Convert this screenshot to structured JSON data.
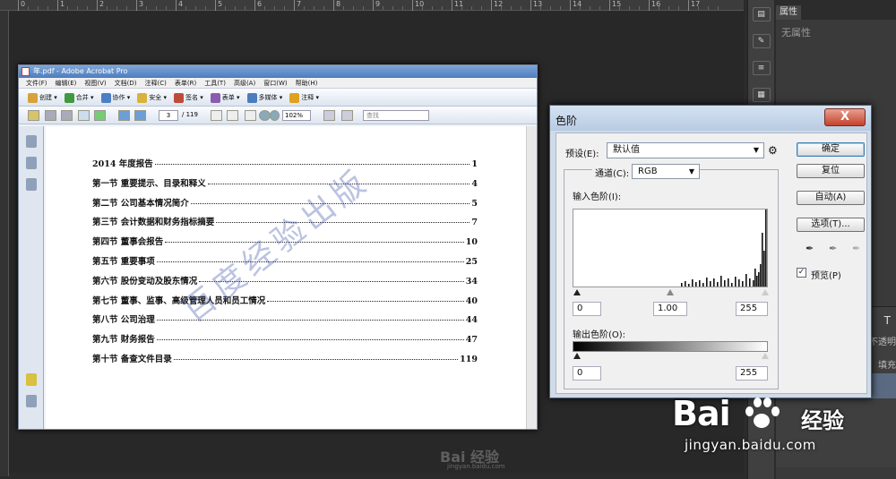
{
  "photoshop": {
    "ruler_marks": [
      "0",
      "1",
      "2",
      "3",
      "4",
      "5",
      "6",
      "7",
      "8",
      "9",
      "10",
      "11",
      "12",
      "13",
      "14",
      "15",
      "16",
      "17"
    ],
    "properties_tab": "属性",
    "properties_empty": "无属性",
    "layers_t": "T",
    "layers_opacity": "不透明",
    "layers_fill": "填充"
  },
  "acrobat": {
    "title": "年.pdf - Adobe Acrobat Pro",
    "menu": [
      "文件(F)",
      "编辑(E)",
      "视图(V)",
      "文档(D)",
      "注释(C)",
      "表单(R)",
      "工具(T)",
      "高级(A)",
      "窗口(W)",
      "帮助(H)"
    ],
    "toolbar": [
      {
        "label": "创建",
        "color": "#d8a23a"
      },
      {
        "label": "合并",
        "color": "#3f9a3f"
      },
      {
        "label": "协作",
        "color": "#4c7fc4"
      },
      {
        "label": "安全",
        "color": "#d8b23a"
      },
      {
        "label": "签名",
        "color": "#c04a3a"
      },
      {
        "label": "表单",
        "color": "#8a5ab0"
      },
      {
        "label": "多媒体",
        "color": "#4a7cbf"
      },
      {
        "label": "注释",
        "color": "#e0a020"
      }
    ],
    "page_current": "3",
    "page_total": "/ 119",
    "zoom": "102%",
    "find_placeholder": "查找",
    "toc": [
      {
        "label": "2014 年度报告",
        "page": "1"
      },
      {
        "label": "第一节  重要提示、目录和释义",
        "page": "4"
      },
      {
        "label": "第二节  公司基本情况简介",
        "page": "5"
      },
      {
        "label": "第三节  会计数据和财务指标摘要",
        "page": "7"
      },
      {
        "label": "第四节  董事会报告",
        "page": "10"
      },
      {
        "label": "第五节  重要事项",
        "page": "25"
      },
      {
        "label": "第六节  股份变动及股东情况",
        "page": "34"
      },
      {
        "label": "第七节  董事、监事、高级管理人员和员工情况",
        "page": "40"
      },
      {
        "label": "第八节  公司治理",
        "page": "44"
      },
      {
        "label": "第九节  财务报告",
        "page": "47"
      },
      {
        "label": "第十节  备查文件目录",
        "page": "119"
      }
    ],
    "watermark": "百度经验出版",
    "wm_logo": "Bai 经验",
    "wm_url": "jingyan.baidu.com"
  },
  "levels": {
    "title": "色阶",
    "close": "X",
    "preset_label": "预设(E):",
    "preset_value": "默认值",
    "channel_label": "通道(C):",
    "channel_value": "RGB",
    "input_label": "输入色阶(I):",
    "input_black": "0",
    "input_gamma": "1.00",
    "input_white": "255",
    "output_label": "输出色阶(O):",
    "output_black": "0",
    "output_white": "255",
    "btn_ok": "确定",
    "btn_reset": "复位",
    "btn_auto": "自动(A)",
    "btn_options": "选项(T)...",
    "preview_label": "预览(P)",
    "preview_checked": true
  },
  "branding": {
    "bai": "Bai",
    "jingyan": "经验",
    "url": "jingyan.baidu.com"
  }
}
